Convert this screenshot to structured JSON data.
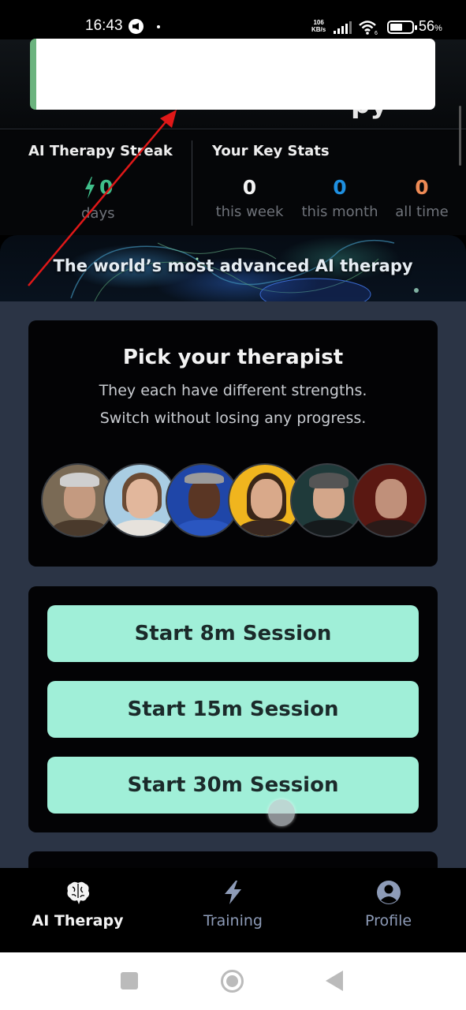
{
  "status_bar": {
    "time": "16:43",
    "net_speed_value": "106",
    "net_speed_unit": "KB/s",
    "wifi_badge": "6",
    "battery_percent": "56",
    "battery_unit": "%"
  },
  "header": {
    "title_fragment": "py"
  },
  "stats": {
    "streak": {
      "title": "AI Therapy Streak",
      "value": "0",
      "unit": "days",
      "color": "#3fbf8a"
    },
    "key_stats": {
      "title": "Your Key Stats",
      "items": [
        {
          "value": "0",
          "label": "this week",
          "color": "#f3f3f3"
        },
        {
          "value": "0",
          "label": "this month",
          "color": "#1e8fe0"
        },
        {
          "value": "0",
          "label": "all time",
          "color": "#ee8a55"
        }
      ]
    }
  },
  "banner": {
    "text": "The world’s most advanced AI therapy"
  },
  "therapist_picker": {
    "title": "Pick your therapist",
    "subtitle_line1": "They each have different strengths.",
    "subtitle_line2": "Switch without losing any progress.",
    "therapists": [
      {
        "name": "therapist-1",
        "bg": "#7a6a55"
      },
      {
        "name": "therapist-2",
        "bg": "#a9cde3"
      },
      {
        "name": "therapist-3",
        "bg": "#1f46a8"
      },
      {
        "name": "therapist-4",
        "bg": "#f0b51e"
      },
      {
        "name": "therapist-5",
        "bg": "#1f3a3a"
      },
      {
        "name": "therapist-6",
        "bg": "#5a1812"
      }
    ]
  },
  "sessions": {
    "buttons": [
      {
        "label": "Start 8m Session"
      },
      {
        "label": "Start 15m Session"
      },
      {
        "label": "Start 30m Session"
      }
    ],
    "button_color": "#a0efd8"
  },
  "bottom_nav": {
    "items": [
      {
        "label": "AI Therapy",
        "icon": "brain-icon",
        "active": true
      },
      {
        "label": "Training",
        "icon": "lightning-icon",
        "active": false
      },
      {
        "label": "Profile",
        "icon": "user-circle-icon",
        "active": false
      }
    ]
  }
}
